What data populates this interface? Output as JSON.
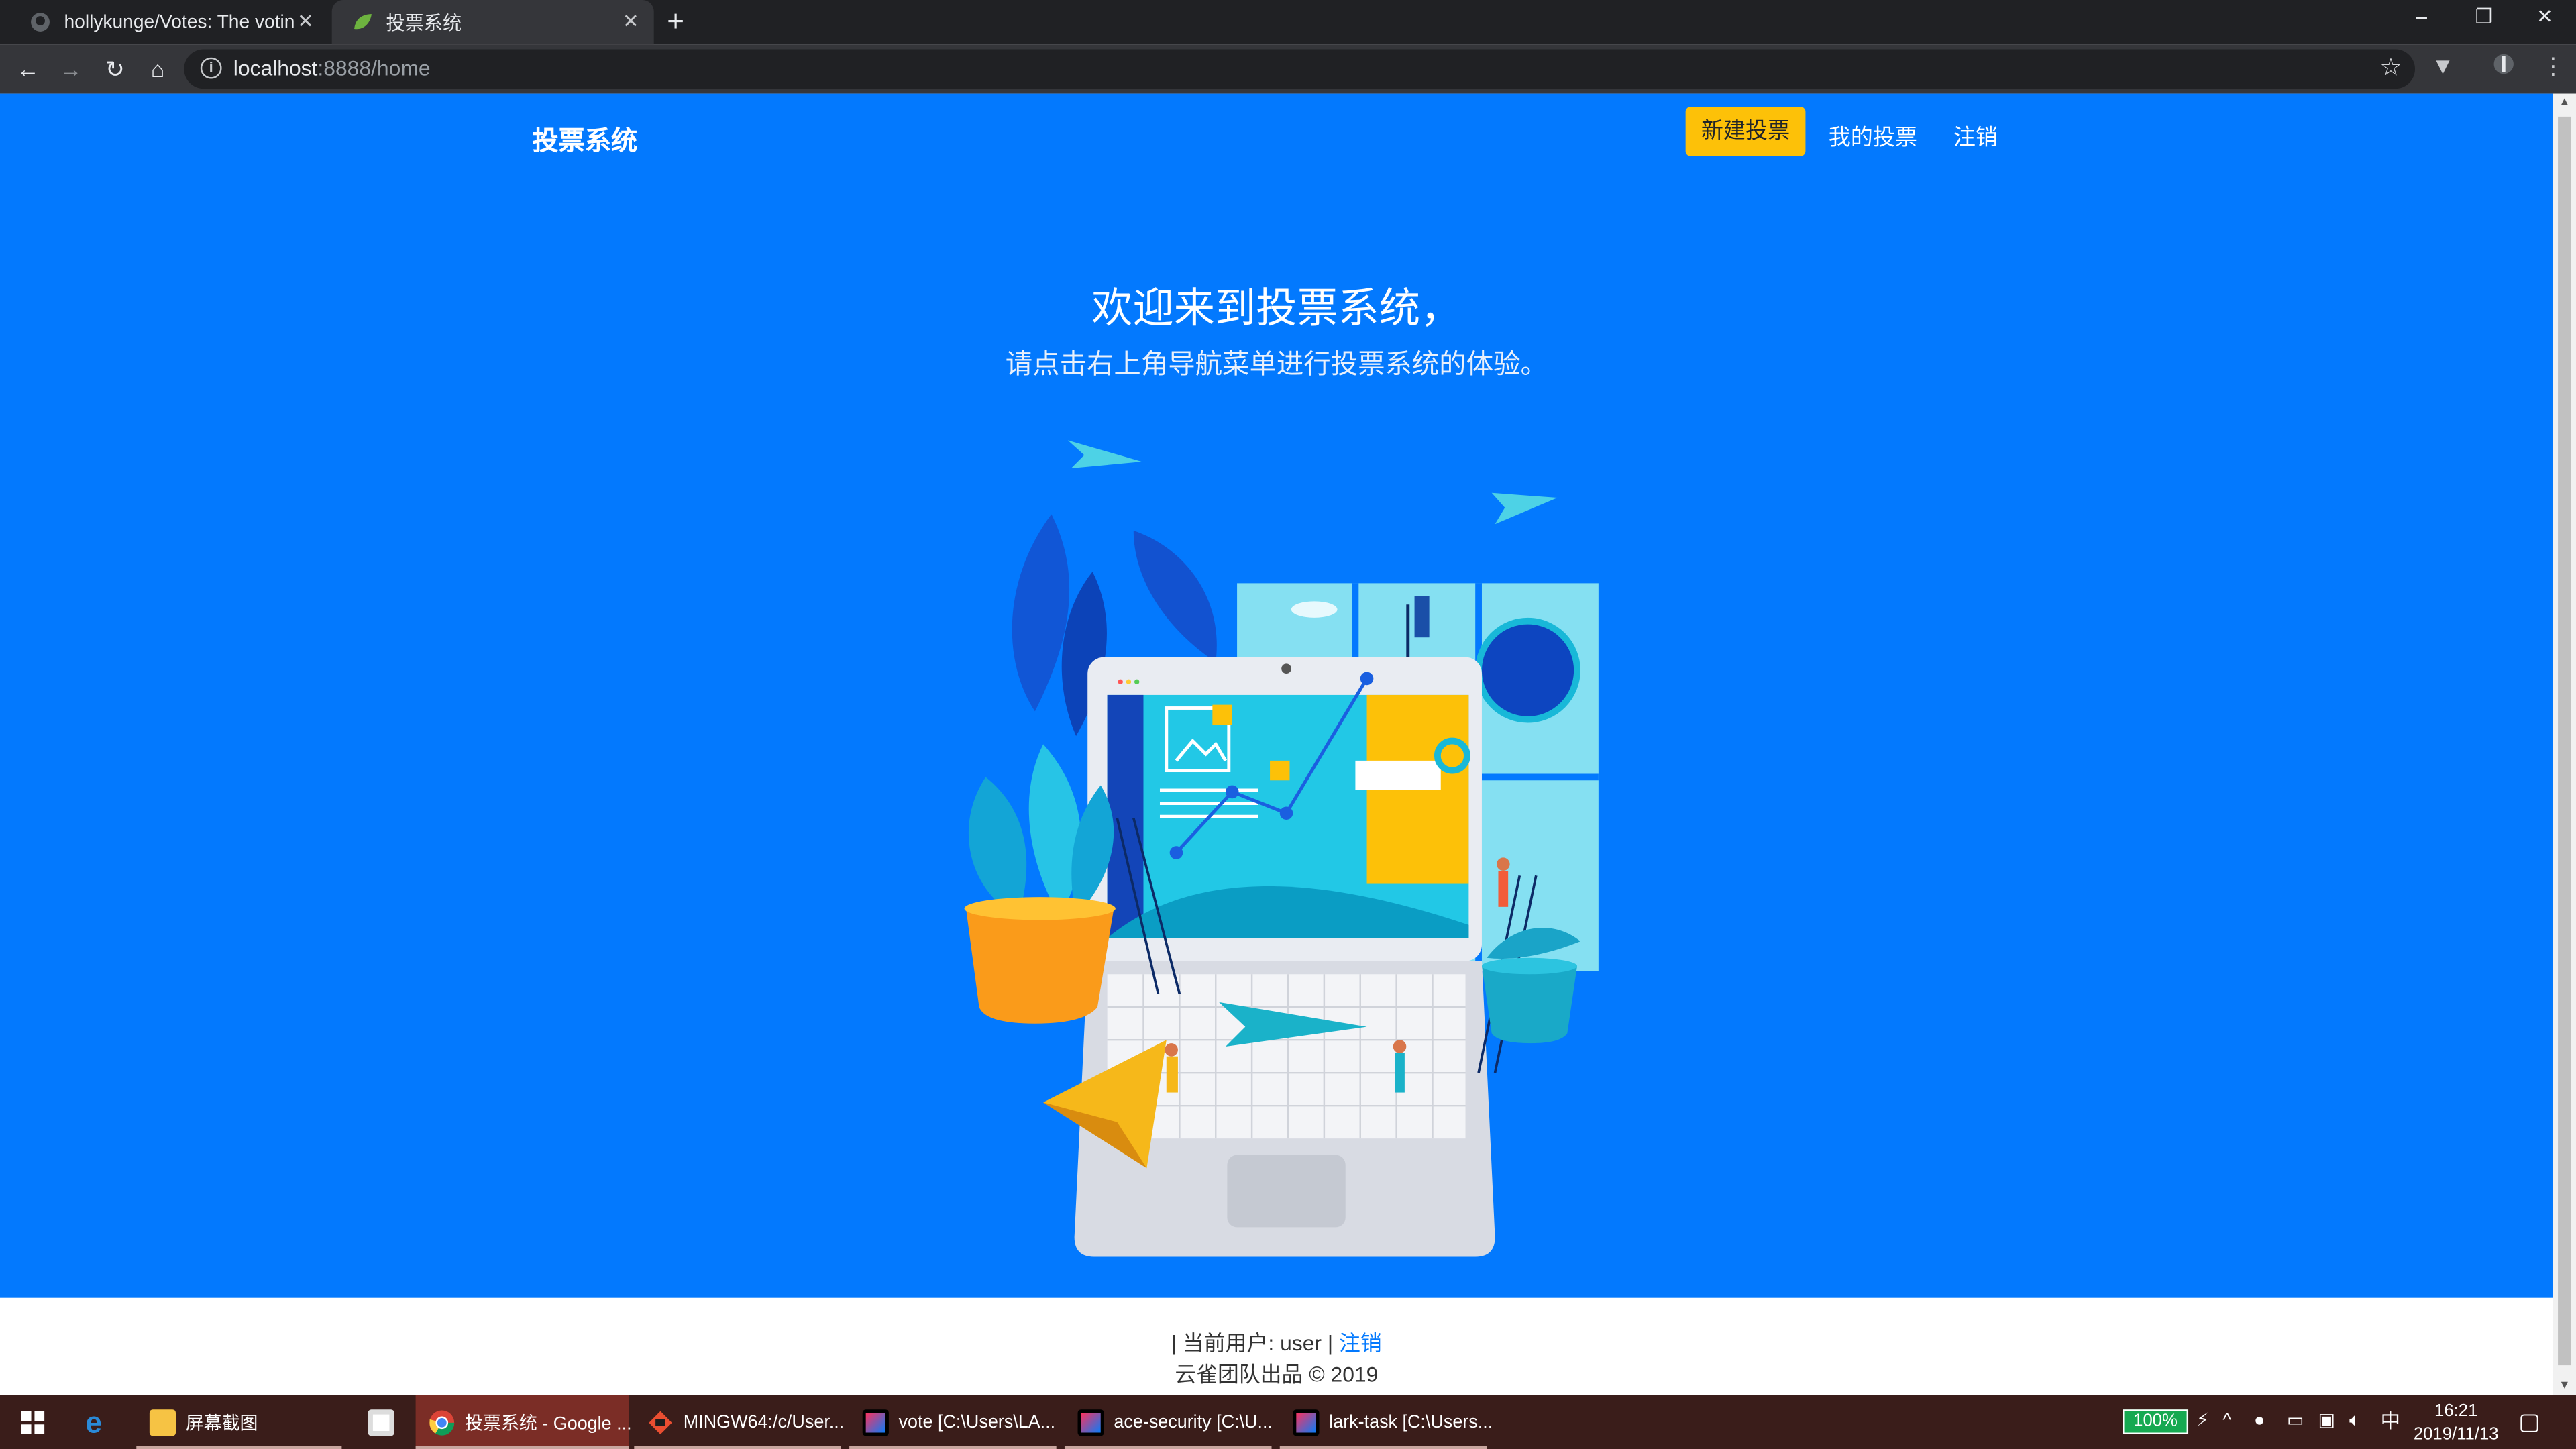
{
  "browser": {
    "tabs": [
      {
        "title": "hollykunge/Votes: The voting",
        "favicon": "github-icon"
      },
      {
        "title": "投票系统",
        "favicon": "spring-leaf-icon"
      }
    ],
    "new_tab": "+",
    "window_controls": {
      "minimize": "–",
      "restore": "❐",
      "close": "✕"
    },
    "nav": {
      "back": "←",
      "forward": "→",
      "reload": "↻",
      "home": "⌂"
    },
    "address": {
      "host": "localhost",
      "path": ":8888/home"
    },
    "bookmark": "☆"
  },
  "app": {
    "brand": "投票系统",
    "nav": {
      "new_vote": "新建投票",
      "my_votes": "我的投票",
      "logout": "注销"
    },
    "hero": {
      "title": "欢迎来到投票系统，",
      "subtitle": "请点击右上角导航菜单进行投票系统的体验。"
    },
    "footer": {
      "user_prefix": "| 当前用户: user |",
      "logout_link": "注销",
      "copyright": "云雀团队出品 © 2019"
    },
    "colors": {
      "hero_bg": "#0379fe",
      "button_bg": "#fdc108"
    }
  },
  "taskbar": {
    "items": [
      {
        "label": "屏幕截图",
        "icon": "folder-icon"
      },
      {
        "label": "投票系统 - Google ...",
        "icon": "chrome-icon"
      },
      {
        "label": "MINGW64:/c/User...",
        "icon": "git-bash-icon"
      },
      {
        "label": "vote [C:\\Users\\LA...",
        "icon": "intellij-icon"
      },
      {
        "label": "ace-security [C:\\U...",
        "icon": "intellij-icon"
      },
      {
        "label": "lark-task [C:\\Users...",
        "icon": "intellij-icon"
      }
    ],
    "battery": "100%",
    "ime": "中",
    "time": "16:21",
    "date": "2019/11/13"
  }
}
